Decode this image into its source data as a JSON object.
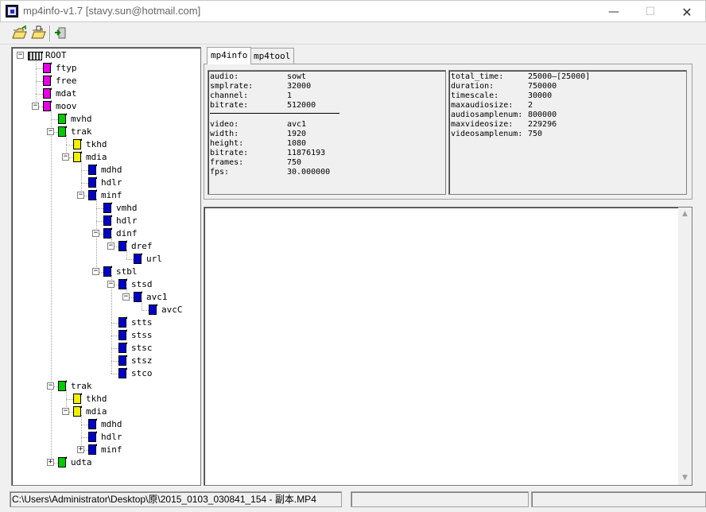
{
  "window": {
    "title": "mp4info-v1.7 [stavy.sun@hotmail.com]",
    "minimize": "—",
    "maximize": "☐",
    "close": "✕"
  },
  "toolbar": {
    "buttons": [
      {
        "name": "open-file",
        "icon": "open-folder-icon"
      },
      {
        "name": "open-folder",
        "icon": "open-folder-icon"
      },
      {
        "name": "exit",
        "icon": "exit-icon"
      }
    ]
  },
  "tree": {
    "nodes": [
      {
        "label": "ROOT",
        "depth": 0,
        "expander": "⊟",
        "icon": "root-icon",
        "color": "#808080"
      },
      {
        "label": "ftyp",
        "depth": 1,
        "expander": "",
        "icon": "box-icon",
        "color": "#e600e6"
      },
      {
        "label": "free",
        "depth": 1,
        "expander": "",
        "icon": "box-icon",
        "color": "#e600e6"
      },
      {
        "label": "mdat",
        "depth": 1,
        "expander": "",
        "icon": "box-icon",
        "color": "#e600e6"
      },
      {
        "label": "moov",
        "depth": 1,
        "expander": "⊟",
        "icon": "box-icon",
        "color": "#e600e6"
      },
      {
        "label": "mvhd",
        "depth": 2,
        "expander": "",
        "icon": "box-icon",
        "color": "#00cc00"
      },
      {
        "label": "trak",
        "depth": 2,
        "expander": "⊟",
        "icon": "box-icon",
        "color": "#00cc00"
      },
      {
        "label": "tkhd",
        "depth": 3,
        "expander": "",
        "icon": "box-icon",
        "color": "#f0f000"
      },
      {
        "label": "mdia",
        "depth": 3,
        "expander": "⊟",
        "icon": "box-icon",
        "color": "#f0f000"
      },
      {
        "label": "mdhd",
        "depth": 4,
        "expander": "",
        "icon": "box-icon",
        "color": "#0000cc"
      },
      {
        "label": "hdlr",
        "depth": 4,
        "expander": "",
        "icon": "box-icon",
        "color": "#0000cc"
      },
      {
        "label": "minf",
        "depth": 4,
        "expander": "⊟",
        "icon": "box-icon",
        "color": "#0000cc"
      },
      {
        "label": "vmhd",
        "depth": 5,
        "expander": "",
        "icon": "box-icon",
        "color": "#0000cc"
      },
      {
        "label": "hdlr",
        "depth": 5,
        "expander": "",
        "icon": "box-icon",
        "color": "#0000cc"
      },
      {
        "label": "dinf",
        "depth": 5,
        "expander": "⊟",
        "icon": "box-icon",
        "color": "#0000cc"
      },
      {
        "label": "dref",
        "depth": 6,
        "expander": "⊟",
        "icon": "box-icon",
        "color": "#0000cc"
      },
      {
        "label": "url",
        "depth": 7,
        "expander": "",
        "icon": "box-icon",
        "color": "#0000cc"
      },
      {
        "label": "stbl",
        "depth": 5,
        "expander": "⊟",
        "icon": "box-icon",
        "color": "#0000cc"
      },
      {
        "label": "stsd",
        "depth": 6,
        "expander": "⊟",
        "icon": "box-icon",
        "color": "#0000cc"
      },
      {
        "label": "avc1",
        "depth": 7,
        "expander": "⊟",
        "icon": "box-icon",
        "color": "#0000cc"
      },
      {
        "label": "avcC",
        "depth": 8,
        "expander": "",
        "icon": "box-icon",
        "color": "#0000cc"
      },
      {
        "label": "stts",
        "depth": 6,
        "expander": "",
        "icon": "box-icon",
        "color": "#0000cc"
      },
      {
        "label": "stss",
        "depth": 6,
        "expander": "",
        "icon": "box-icon",
        "color": "#0000cc"
      },
      {
        "label": "stsc",
        "depth": 6,
        "expander": "",
        "icon": "box-icon",
        "color": "#0000cc"
      },
      {
        "label": "stsz",
        "depth": 6,
        "expander": "",
        "icon": "box-icon",
        "color": "#0000cc"
      },
      {
        "label": "stco",
        "depth": 6,
        "expander": "",
        "icon": "box-icon",
        "color": "#0000cc"
      },
      {
        "label": "trak",
        "depth": 2,
        "expander": "⊟",
        "icon": "box-icon",
        "color": "#00cc00"
      },
      {
        "label": "tkhd",
        "depth": 3,
        "expander": "",
        "icon": "box-icon",
        "color": "#f0f000"
      },
      {
        "label": "mdia",
        "depth": 3,
        "expander": "⊟",
        "icon": "box-icon",
        "color": "#f0f000"
      },
      {
        "label": "mdhd",
        "depth": 4,
        "expander": "",
        "icon": "box-icon",
        "color": "#0000cc"
      },
      {
        "label": "hdlr",
        "depth": 4,
        "expander": "",
        "icon": "box-icon",
        "color": "#0000cc"
      },
      {
        "label": "minf",
        "depth": 4,
        "expander": "⊞",
        "icon": "box-icon",
        "color": "#0000cc"
      },
      {
        "label": "udta",
        "depth": 2,
        "expander": "⊞",
        "icon": "box-icon",
        "color": "#00cc00"
      }
    ]
  },
  "tabs": [
    {
      "label": "mp4info",
      "active": true
    },
    {
      "label": "mp4tool",
      "active": false
    }
  ],
  "info_left": {
    "audio": [
      {
        "key": "audio:",
        "value": "sowt"
      },
      {
        "key": "smplrate:",
        "value": "32000"
      },
      {
        "key": "channel:",
        "value": "1"
      },
      {
        "key": "bitrate:",
        "value": "512000"
      }
    ],
    "video": [
      {
        "key": "video:",
        "value": "avc1"
      },
      {
        "key": "width:",
        "value": "1920"
      },
      {
        "key": "height:",
        "value": "1080"
      },
      {
        "key": "bitrate:",
        "value": "11876193"
      },
      {
        "key": "frames:",
        "value": "750"
      },
      {
        "key": "fps:",
        "value": "30.000000"
      }
    ]
  },
  "info_right": [
    {
      "key": "total_time:",
      "value": "25000—[25000]"
    },
    {
      "key": "duration:",
      "value": "750000"
    },
    {
      "key": "timescale:",
      "value": "30000"
    },
    {
      "key": "maxaudiosize:",
      "value": "2"
    },
    {
      "key": "audiosamplenum:",
      "value": "800000"
    },
    {
      "key": "maxvideosize:",
      "value": "229296"
    },
    {
      "key": "videosamplenum:",
      "value": "750"
    }
  ],
  "status": {
    "path": "C:\\Users\\Administrator\\Desktop\\原\\2015_0103_030841_154 - 副本.MP4",
    "pane2": "",
    "pane3": ""
  }
}
